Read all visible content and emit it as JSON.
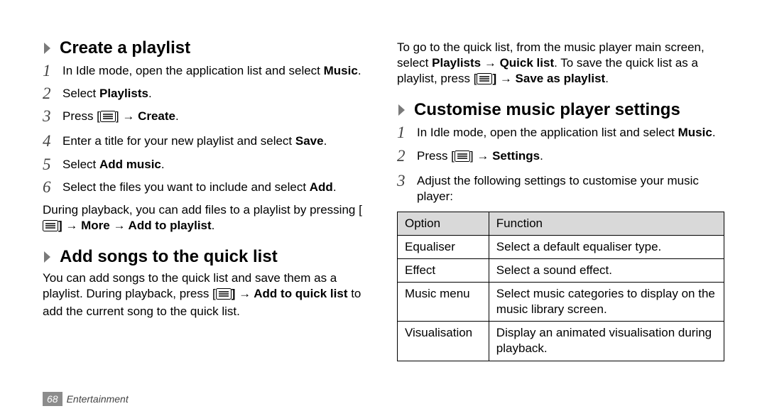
{
  "left": {
    "h1": "Create a playlist",
    "steps1": [
      {
        "pre": "In Idle mode, open the application list and select ",
        "bold": "Music",
        "post": "."
      },
      {
        "pre": "Select ",
        "bold": "Playlists",
        "post": "."
      },
      {
        "pre": "Press [",
        "icon": true,
        "mid": "] → ",
        "bold": "Create",
        "post": "."
      },
      {
        "pre": "Enter a title for your new playlist and select ",
        "bold": "Save",
        "post": "."
      },
      {
        "pre": "Select ",
        "bold": "Add music",
        "post": "."
      },
      {
        "pre": "Select the files you want to include and select ",
        "bold": "Add",
        "post": "."
      }
    ],
    "afterSteps1_pre": "During playback, you can add files to a playlist by pressing [",
    "afterSteps1_bold": "] → More → Add to playlist",
    "afterSteps1_post": ".",
    "h2": "Add songs to the quick list",
    "quick_pre": "You can add songs to the quick list and save them as a playlist. During playback, press [",
    "quick_bold": "] → Add to quick list",
    "quick_post": " to add the current song to the quick list."
  },
  "right": {
    "top_pre": "To go to the quick list, from the music player main screen, select ",
    "top_bold1": "Playlists → Quick list",
    "top_mid": ". To save the quick list as a playlist, press [",
    "top_bold2": "] → Save as playlist",
    "top_post": ".",
    "h1": "Customise music player settings",
    "steps": [
      {
        "pre": "In Idle mode, open the application list and select ",
        "bold": "Music",
        "post": "."
      },
      {
        "pre": "Press [",
        "icon": true,
        "mid": "] → ",
        "bold": "Settings",
        "post": "."
      },
      {
        "pre": "Adjust the following settings to customise your music player:",
        "bold": "",
        "post": ""
      }
    ],
    "table": {
      "headers": [
        "Option",
        "Function"
      ],
      "rows": [
        [
          "Equaliser",
          "Select a default equaliser type."
        ],
        [
          "Effect",
          "Select a sound effect."
        ],
        [
          "Music menu",
          "Select music categories to display on the music library screen."
        ],
        [
          "Visualisation",
          "Display an animated visualisation during playback."
        ]
      ]
    }
  },
  "footer": {
    "page": "68",
    "section": "Entertainment"
  },
  "chart_data": {
    "type": "table",
    "title": "Music player settings",
    "columns": [
      "Option",
      "Function"
    ],
    "rows": [
      [
        "Equaliser",
        "Select a default equaliser type."
      ],
      [
        "Effect",
        "Select a sound effect."
      ],
      [
        "Music menu",
        "Select music categories to display on the music library screen."
      ],
      [
        "Visualisation",
        "Display an animated visualisation during playback."
      ]
    ]
  }
}
